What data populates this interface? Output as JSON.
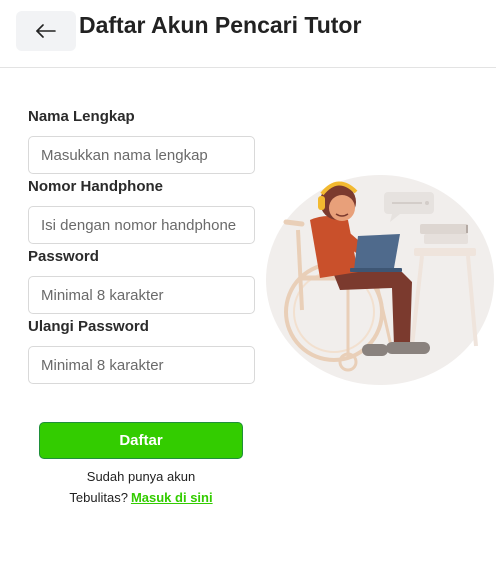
{
  "header": {
    "title": "Daftar Akun Pencari Tutor",
    "back_icon": "arrow-left-icon"
  },
  "form": {
    "name": {
      "label": "Nama Lengkap",
      "placeholder": "Masukkan nama lengkap",
      "value": ""
    },
    "phone": {
      "label": "Nomor Handphone",
      "placeholder": "Isi dengan nomor handphone",
      "value": ""
    },
    "password": {
      "label": "Password",
      "placeholder": "Minimal 8 karakter",
      "value": ""
    },
    "confirm_password": {
      "label": "Ulangi Password",
      "placeholder": "Minimal 8 karakter",
      "value": ""
    },
    "submit_label": "Daftar"
  },
  "login_prompt": {
    "line1": "Sudah punya akun",
    "line2": "Tebulitas?",
    "link_label": "Masuk di sini"
  },
  "colors": {
    "accent_green": "#33cc00",
    "illustration_shirt": "#c9502b",
    "illustration_pants": "#7b3a2e",
    "illustration_background": "#f1eeec"
  }
}
